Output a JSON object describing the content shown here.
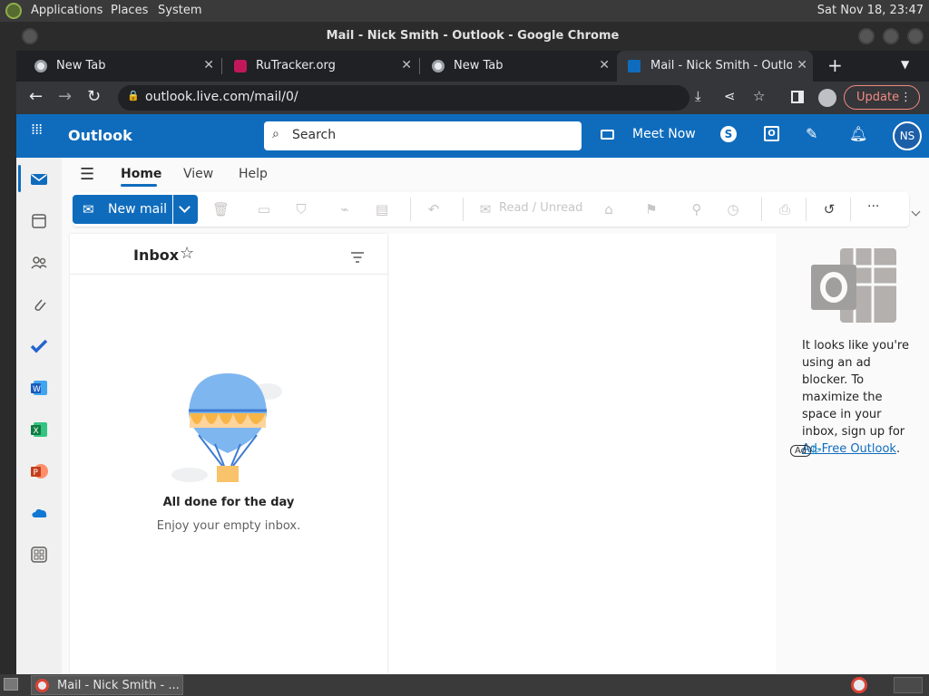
{
  "system_bar": {
    "menu": [
      "Applications",
      "Places",
      "System"
    ],
    "clock": "Sat Nov 18, 23:47"
  },
  "window": {
    "title": "Mail - Nick Smith - Outlook - Google Chrome"
  },
  "tabs": [
    {
      "label": "New Tab",
      "icon": "chrome-icon",
      "active": false
    },
    {
      "label": "RuTracker.org",
      "icon": "rutracker-icon",
      "active": false
    },
    {
      "label": "New Tab",
      "icon": "chrome-icon",
      "active": false
    },
    {
      "label": "Mail - Nick Smith - Outlook",
      "icon": "outlook-icon",
      "active": true
    }
  ],
  "address_bar": {
    "url": "outlook.live.com/mail/0/",
    "update_label": "Update"
  },
  "outlook_header": {
    "app_name": "Outlook",
    "search_placeholder": "Search",
    "meet_now": "Meet Now",
    "avatar_initials": "NS"
  },
  "ribbon": {
    "tabs": [
      "Home",
      "View",
      "Help"
    ],
    "active_tab": "Home",
    "new_mail": "New mail",
    "read_unread": "Read / Unread",
    "more": "···"
  },
  "inbox": {
    "title": "Inbox",
    "empty_title": "All done for the day",
    "empty_subtitle": "Enjoy your empty inbox."
  },
  "ad": {
    "text": "It looks like you're using an ad blocker. To maximize the space in your inbox, sign up for",
    "link": "Ad-Free Outlook",
    "period": ".",
    "badge": "Ad"
  },
  "taskbar": {
    "window_label": "Mail - Nick Smith - ..."
  },
  "colors": {
    "outlook_blue": "#0f6cbd",
    "chrome_dark": "#202124",
    "update_accent": "#f28b82"
  }
}
